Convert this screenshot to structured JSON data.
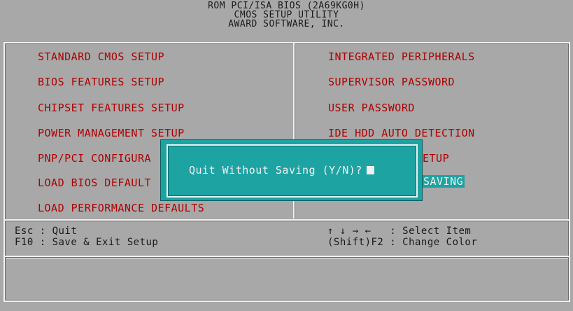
{
  "header": {
    "line1": "ROM PCI/ISA BIOS (2A69KG0H)",
    "line2": "CMOS SETUP UTILITY",
    "line3": "AWARD SOFTWARE, INC."
  },
  "menu": {
    "left": [
      "STANDARD CMOS SETUP",
      "BIOS FEATURES SETUP",
      "CHIPSET FEATURES SETUP",
      "POWER MANAGEMENT SETUP",
      "PNP/PCI CONFIGURA",
      "LOAD BIOS DEFAULT",
      "LOAD PERFORMANCE DEFAULTS"
    ],
    "right": [
      "INTEGRATED PERIPHERALS",
      "SUPERVISOR PASSWORD",
      "USER PASSWORD",
      "IDE HDD AUTO DETECTION",
      "ETUP",
      "SAVING"
    ]
  },
  "help": {
    "esc": "Esc : Quit",
    "f10": "F10 : Save & Exit Setup",
    "arrows": "↑ ↓ → ←   : Select Item",
    "shift": "(Shift)F2 : Change Color"
  },
  "dialog": {
    "prompt": "Quit Without Saving (Y/N)?"
  },
  "colors": {
    "background": "#a8a8a8",
    "menu_text": "#b00000",
    "dialog_bg": "#1ea3a3"
  }
}
